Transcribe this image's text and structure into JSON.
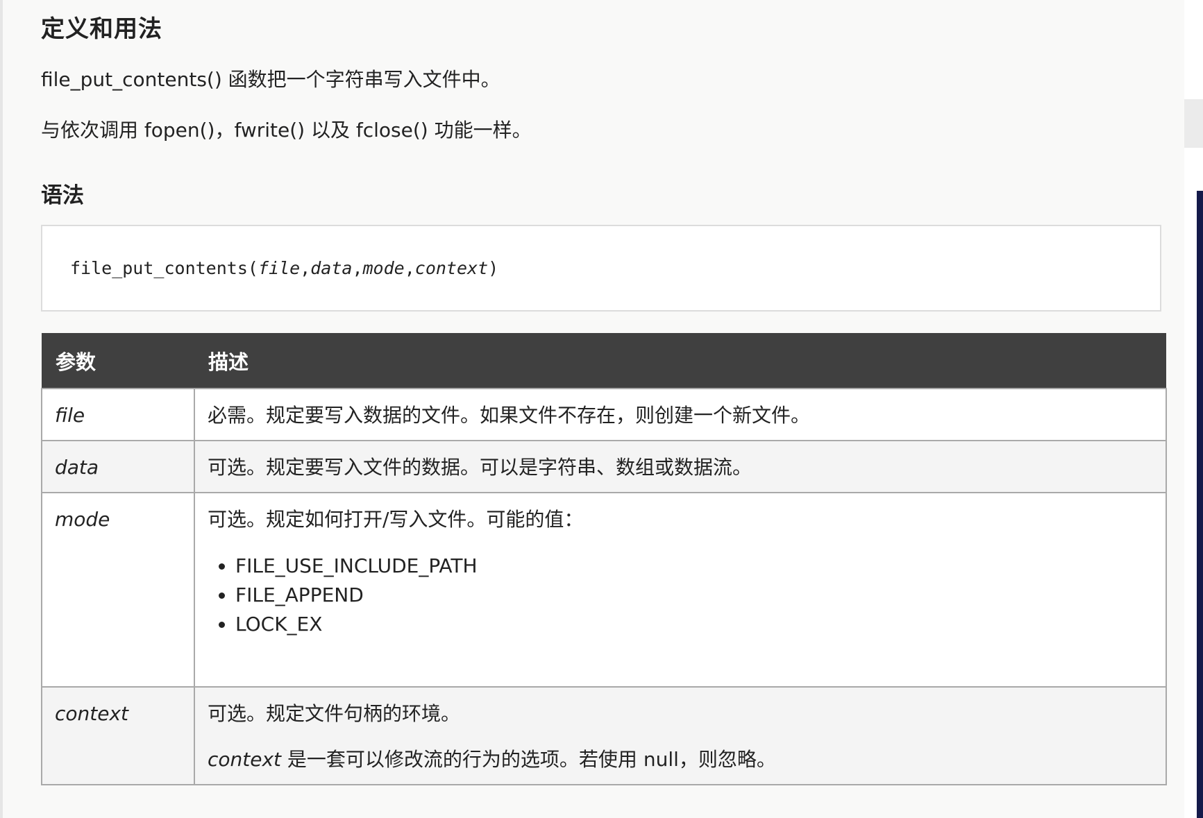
{
  "heading": "定义和用法",
  "intro": {
    "line1": "file_put_contents() 函数把一个字符串写入文件中。",
    "line2": "与依次调用 fopen()，fwrite() 以及 fclose() 功能一样。"
  },
  "syntax": {
    "title": "语法",
    "fn_name": "file_put_contents(",
    "args": [
      "file",
      "data",
      "mode",
      "context"
    ],
    "separator": ",",
    "close": ")"
  },
  "table": {
    "headers": [
      "参数",
      "描述"
    ],
    "rows": [
      {
        "param": "file",
        "desc": "必需。规定要写入数据的文件。如果文件不存在，则创建一个新文件。"
      },
      {
        "param": "data",
        "desc": "可选。规定要写入文件的数据。可以是字符串、数组或数据流。"
      },
      {
        "param": "mode",
        "desc": "可选。规定如何打开/写入文件。可能的值：",
        "options": [
          "FILE_USE_INCLUDE_PATH",
          "FILE_APPEND",
          "LOCK_EX"
        ]
      },
      {
        "param": "context",
        "desc": "可选。规定文件句柄的环境。",
        "note_em": "context",
        "note_rest": " 是一套可以修改流的行为的选项。若使用 null，则忽略。"
      }
    ]
  }
}
